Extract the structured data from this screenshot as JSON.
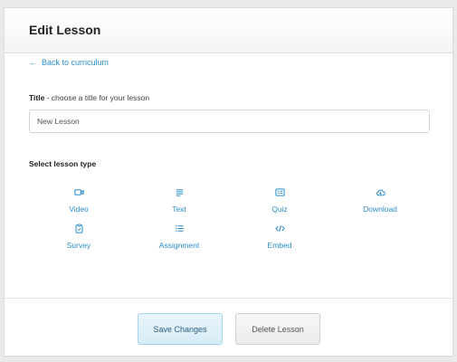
{
  "header": {
    "title": "Edit Lesson"
  },
  "nav": {
    "back_label": "Back to curriculum",
    "back_arrow": "←"
  },
  "title_field": {
    "label_bold": "Title",
    "label_hint": " - choose a title for your lesson",
    "value": "New Lesson"
  },
  "lesson_type": {
    "heading": "Select lesson type",
    "options": [
      {
        "label": "Video",
        "icon": "video-icon"
      },
      {
        "label": "Text",
        "icon": "text-icon"
      },
      {
        "label": "Quiz",
        "icon": "quiz-icon"
      },
      {
        "label": "Download",
        "icon": "cloud-download-icon"
      },
      {
        "label": "Survey",
        "icon": "clipboard-icon"
      },
      {
        "label": "Assignment",
        "icon": "list-icon"
      },
      {
        "label": "Embed",
        "icon": "code-icon"
      }
    ]
  },
  "actions": {
    "save_label": "Save Changes",
    "delete_label": "Delete Lesson"
  },
  "colors": {
    "accent": "#2a8fc9",
    "save_bg": "#dff0fa",
    "page_bg": "#e9e9e9"
  }
}
